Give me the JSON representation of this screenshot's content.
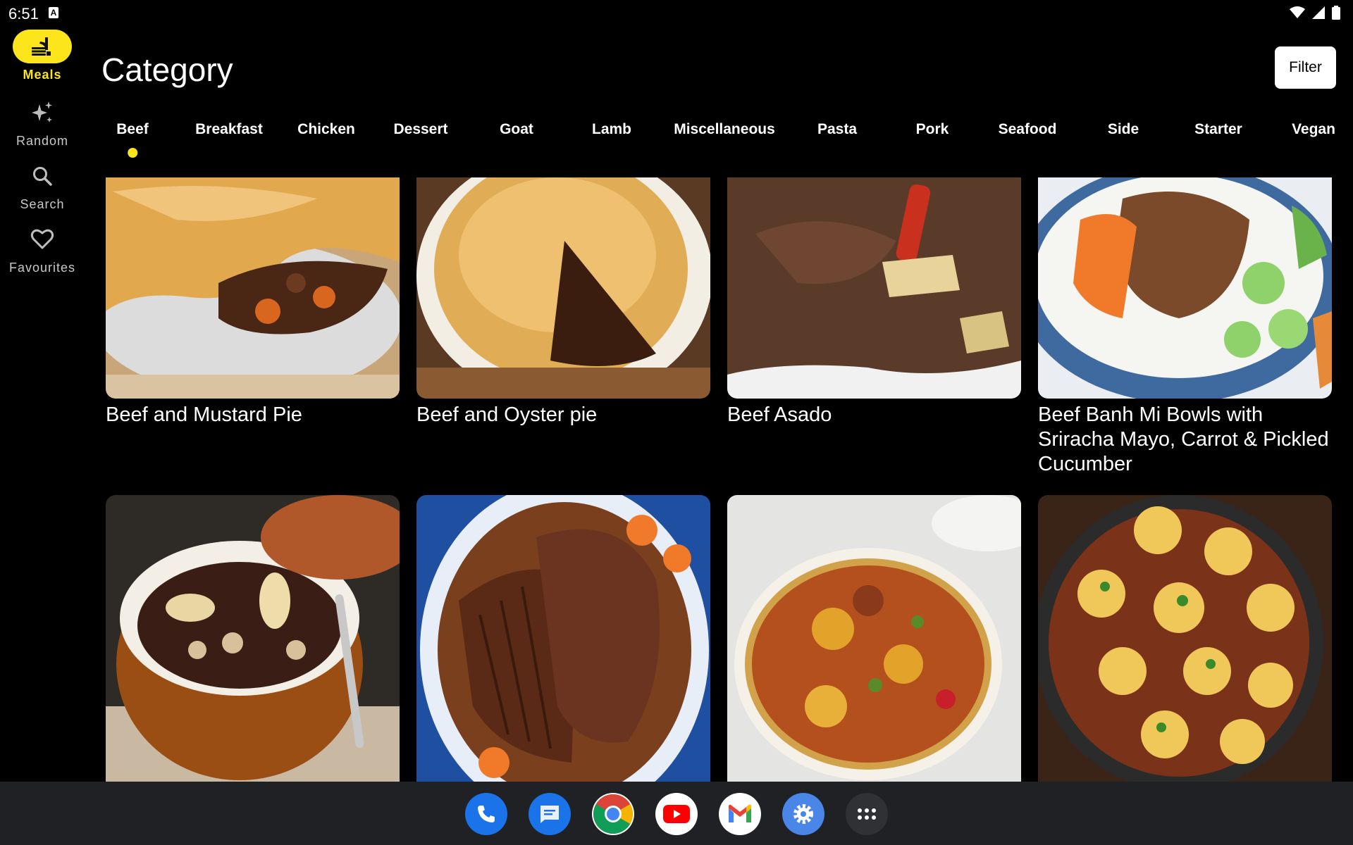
{
  "status_bar": {
    "time": "6:51",
    "notification_letter": "A"
  },
  "nav": {
    "items": [
      {
        "label": "Meals",
        "icon": "meals-icon",
        "active": true
      },
      {
        "label": "Random",
        "icon": "sparkle-icon",
        "active": false
      },
      {
        "label": "Search",
        "icon": "search-icon",
        "active": false
      },
      {
        "label": "Favourites",
        "icon": "heart-outline-icon",
        "active": false
      }
    ]
  },
  "header": {
    "title": "Category",
    "filter_label": "Filter"
  },
  "tabs": [
    {
      "label": "Beef",
      "selected": true
    },
    {
      "label": "Breakfast"
    },
    {
      "label": "Chicken"
    },
    {
      "label": "Dessert"
    },
    {
      "label": "Goat"
    },
    {
      "label": "Lamb"
    },
    {
      "label": "Miscellaneous"
    },
    {
      "label": "Pasta"
    },
    {
      "label": "Pork"
    },
    {
      "label": "Seafood"
    },
    {
      "label": "Side"
    },
    {
      "label": "Starter"
    },
    {
      "label": "Vegan"
    }
  ],
  "meals": [
    {
      "title": "Beef and Mustard Pie"
    },
    {
      "title": "Beef and Oyster pie"
    },
    {
      "title": "Beef Asado"
    },
    {
      "title": "Beef Banh Mi Bowls with Sriracha Mayo, Carrot & Pickled Cucumber"
    },
    {
      "title": ""
    },
    {
      "title": ""
    },
    {
      "title": ""
    },
    {
      "title": ""
    }
  ],
  "dock": {
    "apps": [
      "phone-app-icon",
      "messages-app-icon",
      "chrome-app-icon",
      "youtube-app-icon",
      "gmail-app-icon",
      "settings-app-icon",
      "app-drawer-icon"
    ]
  },
  "colors": {
    "accent": "#fce51a",
    "background": "#000000",
    "dock": "#202124"
  }
}
